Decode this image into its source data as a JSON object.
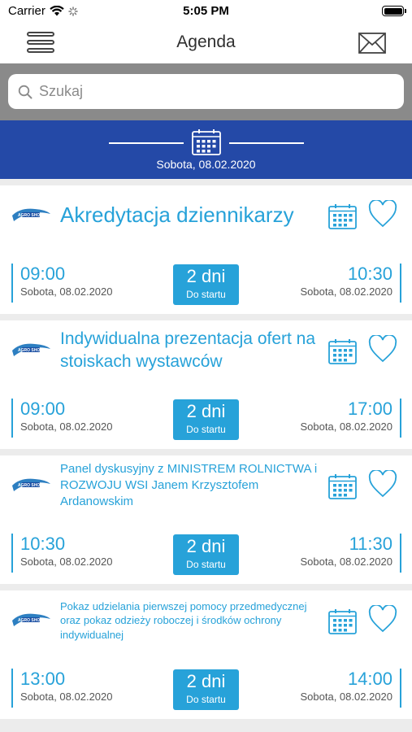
{
  "status": {
    "carrier": "Carrier",
    "time": "5:05 PM"
  },
  "nav": {
    "title": "Agenda"
  },
  "search": {
    "placeholder": "Szukaj"
  },
  "date_header": {
    "date": "Sobota, 08.02.2020"
  },
  "events": [
    {
      "title": "Akredytacja dziennikarzy",
      "start_time": "09:00",
      "start_date": "Sobota, 08.02.2020",
      "badge_value": "2 dni",
      "badge_label": "Do startu",
      "end_time": "10:30",
      "end_date": "Sobota, 08.02.2020"
    },
    {
      "title": "Indywidualna prezentacja ofert na stoiskach wystawców",
      "start_time": "09:00",
      "start_date": "Sobota, 08.02.2020",
      "badge_value": "2 dni",
      "badge_label": "Do startu",
      "end_time": "17:00",
      "end_date": "Sobota, 08.02.2020"
    },
    {
      "title": "Panel dyskusyjny z MINISTREM ROLNICTWA i ROZWOJU WSI Janem Krzysztofem Ardanowskim",
      "start_time": "10:30",
      "start_date": "Sobota, 08.02.2020",
      "badge_value": "2 dni",
      "badge_label": "Do startu",
      "end_time": "11:30",
      "end_date": "Sobota, 08.02.2020"
    },
    {
      "title": "Pokaz udzielania pierwszej pomocy przedmedycznej oraz pokaz odzieży roboczej i środków ochrony indywidualnej",
      "start_time": "13:00",
      "start_date": "Sobota, 08.02.2020",
      "badge_value": "2 dni",
      "badge_label": "Do startu",
      "end_time": "14:00",
      "end_date": "Sobota, 08.02.2020"
    }
  ],
  "icons": {
    "menu": "hamburger-icon",
    "mail": "envelope-icon",
    "search": "magnifier-icon",
    "calendar": "calendar-icon",
    "favorite": "heart-icon",
    "logo": "agro-show-logo"
  },
  "colors": {
    "accent": "#27a2d9",
    "header_blue": "#2449a7",
    "search_bg": "#8a8a8a"
  }
}
